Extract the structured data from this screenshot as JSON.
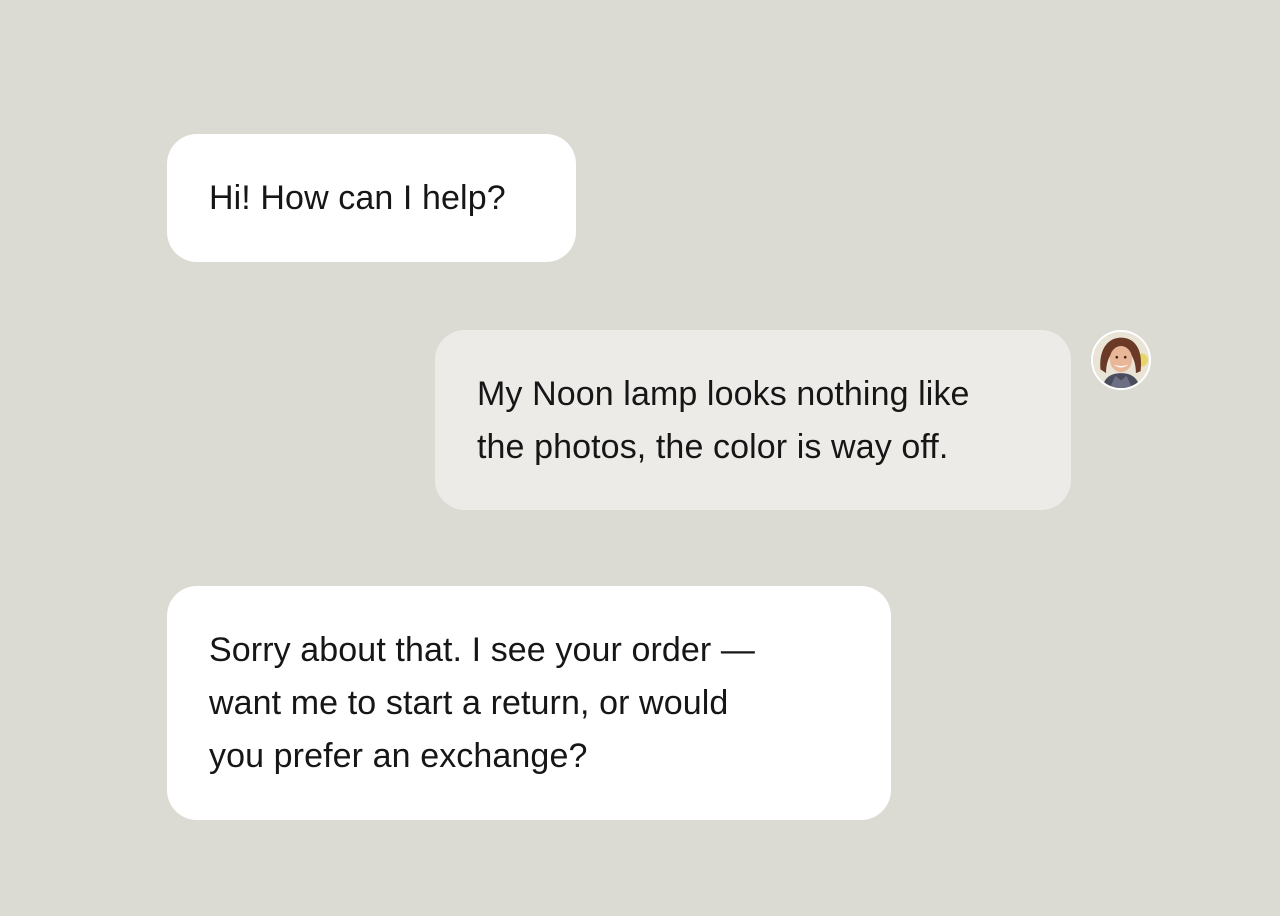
{
  "conversation": {
    "messages": [
      {
        "sender": "agent",
        "lines": [
          "Hi! How can I help?"
        ]
      },
      {
        "sender": "user",
        "lines": [
          "My Noon lamp looks nothing like",
          "the photos, the color is way off."
        ]
      },
      {
        "sender": "agent",
        "lines": [
          "Sorry about that. I see your order —",
          "want me to start a return, or would",
          "you prefer an exchange?"
        ]
      }
    ],
    "user_avatar": {
      "icon": "user-avatar-photo"
    }
  },
  "colors": {
    "background": "#dcdbd3",
    "agent_bubble": "#ffffff",
    "user_bubble": "#ecebe7",
    "text": "#161616"
  }
}
